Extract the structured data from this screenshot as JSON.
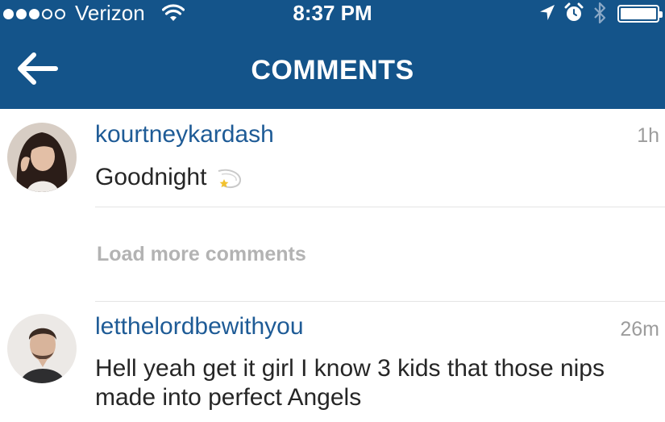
{
  "status_bar": {
    "carrier": "Verizon",
    "time": "8:37 PM",
    "signal_bars_filled": 3,
    "signal_bars_total": 5,
    "battery_level": 1.0
  },
  "nav": {
    "title": "COMMENTS",
    "back_icon": "arrow-left-icon"
  },
  "comments": [
    {
      "username": "kourtneykardash",
      "timestamp": "1h",
      "text": "Goodnight",
      "emoji": "dizzy-star-icon"
    }
  ],
  "load_more": "Load more comments",
  "replies": [
    {
      "username": "letthelordbewithyou",
      "timestamp": "26m",
      "text": "Hell yeah get it girl I know 3 kids that those nips made into perfect Angels"
    }
  ],
  "colors": {
    "header_bg": "#14548a",
    "username": "#1e5b96",
    "timestamp": "#9c9c9c",
    "load_more": "#b3b3b3"
  }
}
